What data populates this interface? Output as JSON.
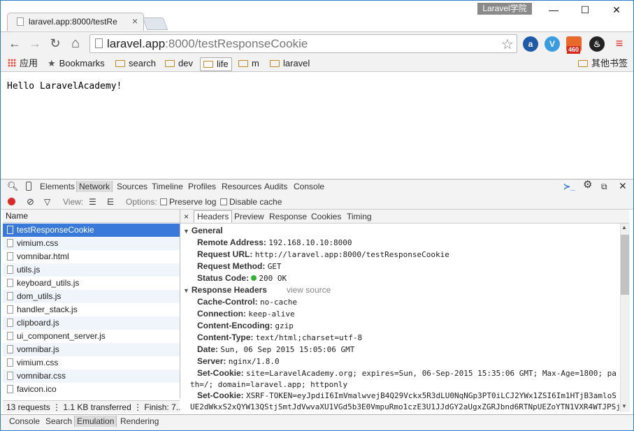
{
  "window": {
    "profile_label": "Laravel学院",
    "minimize": "—",
    "maximize": "☐",
    "close": "✕"
  },
  "tab": {
    "title": "laravel.app:8000/testRe",
    "close": "×"
  },
  "toolbar": {
    "back": "←",
    "forward": "→",
    "reload": "↻",
    "home": "⌂",
    "url_host": "laravel.app",
    "url_rest": ":8000/testResponseCookie",
    "star": "☆",
    "badge_460": "460",
    "menu": "≡"
  },
  "bookmarks": {
    "apps": "应用",
    "star_label": "Bookmarks",
    "folders": [
      "search",
      "dev",
      "life",
      "m",
      "laravel"
    ],
    "other": "其他书签"
  },
  "page": {
    "text": "Hello LaravelAcademy!"
  },
  "devtools": {
    "tabs": [
      "Elements",
      "Network",
      "Sources",
      "Timeline",
      "Profiles",
      "Resources",
      "Audits",
      "Console"
    ],
    "toolbar": {
      "view_label": "View:",
      "options_label": "Options:",
      "preserve_log": "Preserve log",
      "disable_cache": "Disable cache"
    },
    "name_header": "Name",
    "requests": [
      "testResponseCookie",
      "vimium.css",
      "vomnibar.html",
      "utils.js",
      "keyboard_utils.js",
      "dom_utils.js",
      "handler_stack.js",
      "clipboard.js",
      "ui_component_server.js",
      "vomnibar.js",
      "vimium.css",
      "vomnibar.css",
      "favicon.ico"
    ],
    "status_summary": "13 requests  ⋮  1.1 KB transferred  ⋮  Finish: 7...",
    "detail_tabs": [
      "Headers",
      "Preview",
      "Response",
      "Cookies",
      "Timing"
    ],
    "detail_close": "×",
    "general": {
      "title": "General",
      "remote_address_k": "Remote Address:",
      "remote_address_v": "192.168.10.10:8000",
      "request_url_k": "Request URL:",
      "request_url_v": "http://laravel.app:8000/testResponseCookie",
      "request_method_k": "Request Method:",
      "request_method_v": "GET",
      "status_code_k": "Status Code:",
      "status_code_v": "200 OK"
    },
    "response_headers": {
      "title": "Response Headers",
      "view_source": "view source",
      "cache_control_k": "Cache-Control:",
      "cache_control_v": "no-cache",
      "connection_k": "Connection:",
      "connection_v": "keep-alive",
      "content_encoding_k": "Content-Encoding:",
      "content_encoding_v": "gzip",
      "content_type_k": "Content-Type:",
      "content_type_v": "text/html;charset=utf-8",
      "date_k": "Date:",
      "date_v": "Sun, 06 Sep 2015 15:05:06 GMT",
      "server_k": "Server:",
      "server_v": "nginx/1.8.0",
      "set_cookie_k": "Set-Cookie:",
      "set_cookie_v1": "site=LaravelAcademy.org; expires=Sun, 06-Sep-2015 15:35:06 GMT; Max-Age=1800; pa",
      "set_cookie_v1b": "th=/; domain=laravel.app; httponly",
      "set_cookie2_k": "Set-Cookie:",
      "set_cookie2_v": "XSRF-TOKEN=eyJpdiI6ImVmalwvejB4Q29Vckx5R3dLU0NqNGp3PT0iLCJ2YWx1ZSI6Im1HTjB3amloS",
      "set_cookie2_vb": "UE2dWkxS2xQYW13QStjSmtJdVwvaXU1VGd5b3E0VmpuRmo1czE3U1JJdGY2aUgxZGRJbnd6RTNpUEZoYTN1VXR4WTJPSj"
    },
    "bottom_tabs": [
      "Console",
      "Search",
      "Emulation",
      "Rendering"
    ]
  }
}
